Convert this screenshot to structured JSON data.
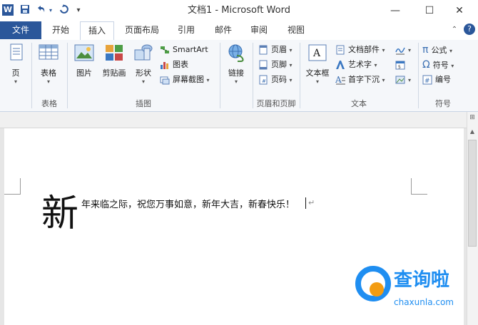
{
  "window": {
    "title": "文档1 - Microsoft Word",
    "app_icon": "W",
    "quick_access": [
      "save-icon",
      "undo-icon",
      "undo-dropdown",
      "redo-icon",
      "customize-icon"
    ],
    "controls": [
      "minimize-icon",
      "maximize-icon",
      "close-icon"
    ]
  },
  "tabs": [
    {
      "label": "文件"
    },
    {
      "label": "开始"
    },
    {
      "label": "插入"
    },
    {
      "label": "页面布局"
    },
    {
      "label": "引用"
    },
    {
      "label": "邮件"
    },
    {
      "label": "审阅"
    },
    {
      "label": "视图"
    }
  ],
  "ribbon": {
    "pages": {
      "label": "页",
      "group": ""
    },
    "tables": {
      "label": "表格",
      "group": "表格"
    },
    "illustrations": {
      "picture": "图片",
      "clipart": "剪贴画",
      "shapes": "形状",
      "smartart": "SmartArt",
      "chart": "图表",
      "screenshot": "屏幕截图",
      "group": "插图"
    },
    "links": {
      "label": "链接",
      "group": ""
    },
    "header_footer": {
      "header": "页眉",
      "footer": "页脚",
      "page_number": "页码",
      "group": "页眉和页脚"
    },
    "text": {
      "textbox": "文本框",
      "quick_parts": "文档部件",
      "wordart": "艺术字",
      "dropcap": "首字下沉",
      "group": "文本"
    },
    "symbols": {
      "equation": "公式",
      "symbol": "符号",
      "number": "编号",
      "group": "符号",
      "equation_glyph": "π",
      "symbol_glyph": "Ω"
    }
  },
  "document": {
    "drop_cap": "新",
    "body": "年来临之际，祝您万事如意，新年大吉，新春快乐！"
  },
  "watermark": {
    "title": "查询啦",
    "subtitle": "chaxunla.com"
  },
  "colors": {
    "accent": "#2b579a",
    "watermark": "#1f8ef1",
    "watermark_dot": "#f39c12"
  }
}
